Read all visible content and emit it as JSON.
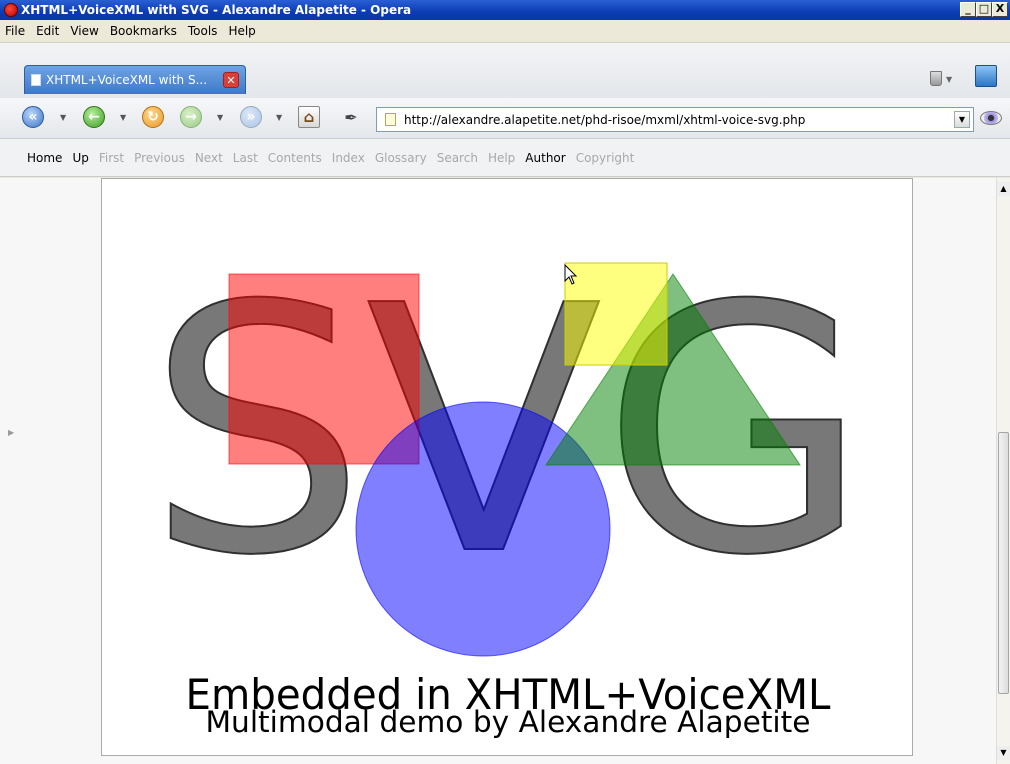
{
  "window": {
    "title": "XHTML+VoiceXML with SVG - Alexandre Alapetite - Opera",
    "min": "_",
    "max": "□",
    "close": "X"
  },
  "menu": [
    "File",
    "Edit",
    "View",
    "Bookmarks",
    "Tools",
    "Help"
  ],
  "tab": {
    "label": "XHTML+VoiceXML with S...",
    "close": "✕"
  },
  "address": {
    "url": "http://alexandre.alapetite.net/phd-risoe/mxml/xhtml-voice-svg.php"
  },
  "links": [
    {
      "label": "Home",
      "enabled": true
    },
    {
      "label": "Up",
      "enabled": true
    },
    {
      "label": "First",
      "enabled": false
    },
    {
      "label": "Previous",
      "enabled": false
    },
    {
      "label": "Next",
      "enabled": false
    },
    {
      "label": "Last",
      "enabled": false
    },
    {
      "label": "Contents",
      "enabled": false
    },
    {
      "label": "Index",
      "enabled": false
    },
    {
      "label": "Glossary",
      "enabled": false
    },
    {
      "label": "Search",
      "enabled": false
    },
    {
      "label": "Help",
      "enabled": false
    },
    {
      "label": "Author",
      "enabled": true
    },
    {
      "label": "Copyright",
      "enabled": false
    }
  ],
  "graphic": {
    "big_text": "SVG",
    "line1": "Embedded in XHTML+VoiceXML",
    "line2": "Multimodal demo by Alexandre Alapetite",
    "colors": {
      "text": "#606060",
      "square": "#ff0000",
      "circle": "#0000ff",
      "triangle": "#008000",
      "small_square": "#ffff00"
    }
  }
}
